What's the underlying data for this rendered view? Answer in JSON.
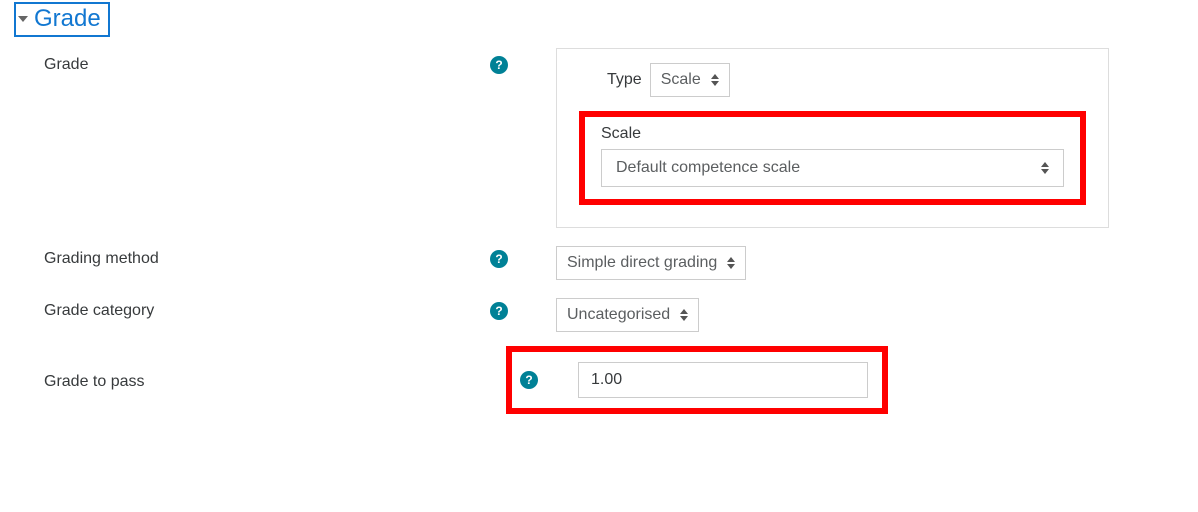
{
  "section": {
    "title": "Grade"
  },
  "grade": {
    "label": "Grade",
    "type_label": "Type",
    "type_value": "Scale",
    "scale_label": "Scale",
    "scale_value": "Default competence scale"
  },
  "grading_method": {
    "label": "Grading method",
    "value": "Simple direct grading"
  },
  "grade_category": {
    "label": "Grade category",
    "value": "Uncategorised"
  },
  "grade_to_pass": {
    "label": "Grade to pass",
    "value": "1.00"
  }
}
